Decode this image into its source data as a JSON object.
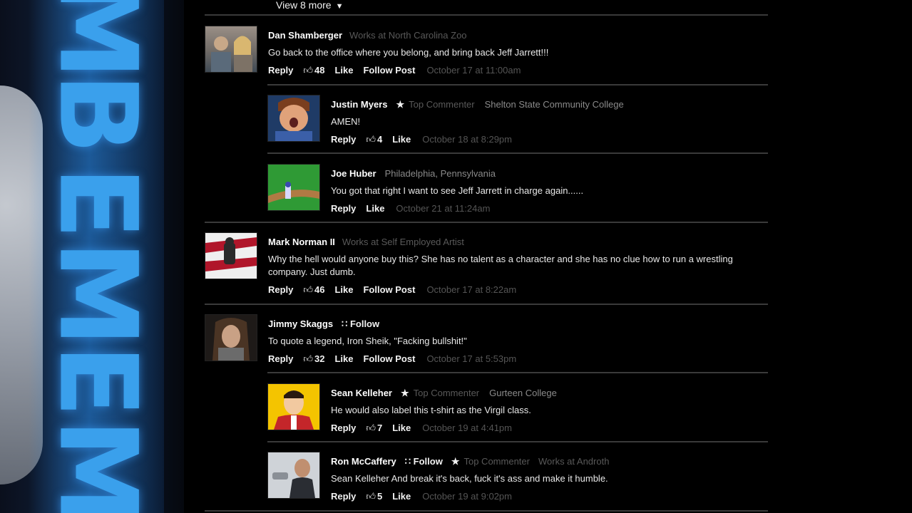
{
  "sidebar_banner": {
    "letters": [
      "M",
      "B",
      "E",
      "M",
      "E",
      "M"
    ]
  },
  "view_more": {
    "label": "View 8 more"
  },
  "comments": [
    {
      "name": "Dan Shamberger",
      "meta": "Works at North Carolina Zoo",
      "text": "Go back to the office where you belong, and bring back Jeff Jarrett!!!",
      "reply": "Reply",
      "likes": "48",
      "like": "Like",
      "follow_post": "Follow Post",
      "time": "October 17 at 11:00am"
    },
    {
      "name": "Justin Myers",
      "badge": "Top Commenter",
      "meta": "Shelton State Community College",
      "text": "AMEN!",
      "reply": "Reply",
      "likes": "4",
      "like": "Like",
      "time": "October 18 at 8:29pm"
    },
    {
      "name": "Joe Huber",
      "meta": "Philadelphia, Pennsylvania",
      "text": "You got that right I want to see Jeff Jarrett in charge again......",
      "reply": "Reply",
      "like": "Like",
      "time": "October 21 at 11:24am"
    },
    {
      "name": "Mark Norman II",
      "meta": "Works at Self Employed Artist",
      "text": "Why the hell would anyone buy this? She has no talent as a character and she has no clue how to run a wrestling company. Just dumb.",
      "reply": "Reply",
      "likes": "46",
      "like": "Like",
      "follow_post": "Follow Post",
      "time": "October 17 at 8:22am"
    },
    {
      "name": "Jimmy Skaggs",
      "follow": "Follow",
      "text": "To quote a legend, Iron Sheik, \"Facking bullshit!\"",
      "reply": "Reply",
      "likes": "32",
      "like": "Like",
      "follow_post": "Follow Post",
      "time": "October 17 at 5:53pm"
    },
    {
      "name": "Sean Kelleher",
      "badge": "Top Commenter",
      "meta": "Gurteen College",
      "text": "He would also label this t-shirt as the Virgil class.",
      "reply": "Reply",
      "likes": "7",
      "like": "Like",
      "time": "October 19 at 4:41pm"
    },
    {
      "name": "Ron McCaffery",
      "follow": "Follow",
      "badge": "Top Commenter",
      "meta": "Works at Androth",
      "text": "Sean Kelleher And break it's back, fuck it's ass and make it humble.",
      "reply": "Reply",
      "likes": "5",
      "like": "Like",
      "time": "October 19 at 9:02pm"
    }
  ],
  "colors": {
    "background": "#000000",
    "divider": "#3a3a3a",
    "muted": "#555555",
    "banner_blue": "#3aa0ec"
  },
  "icons": {
    "thumbs_up": "thumbs-up-icon",
    "star": "star-icon",
    "rss_follow": "rss-icon",
    "caret": "caret-down-icon"
  }
}
